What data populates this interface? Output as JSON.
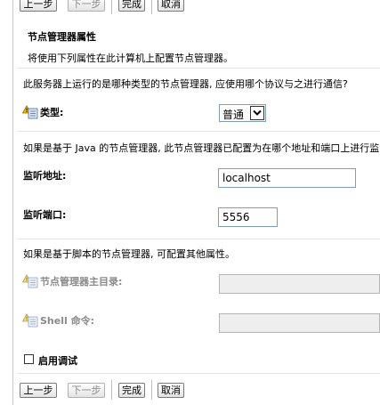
{
  "toolbar": {
    "back": "上一步",
    "next": "下一步",
    "finish": "完成",
    "cancel": "取消"
  },
  "section": {
    "title": "节点管理器属性",
    "description": "将使用下列属性在此计算机上配置节点管理器。"
  },
  "type_prompt": "此服务器上运行的是哪种类型的节点管理器, 应使用哪个协议与之进行通信?",
  "type_field": {
    "label": "类型:",
    "value": "普通"
  },
  "java_prompt": "如果是基于 Java 的节点管理器, 此节点管理器已配置为在哪个地址和端口上进行监听?",
  "listen_address": {
    "label": "监听地址:",
    "value": "localhost"
  },
  "listen_port": {
    "label": "监听端口:",
    "value": "5556"
  },
  "script_prompt": "如果是基于脚本的节点管理器, 可配置其他属性。",
  "home_dir": {
    "label": "节点管理器主目录:",
    "value": ""
  },
  "shell_command": {
    "label": "Shell 命令:",
    "value": ""
  },
  "debug": {
    "label": "启用调试",
    "checked": false
  },
  "icons": {
    "required": "change-warning-icon",
    "dropdown": "chevron-down-icon"
  },
  "colors": {
    "input_border": "#7f9db9",
    "disabled_text": "#8a8a8a",
    "disabled_bg": "#eeeeee"
  }
}
